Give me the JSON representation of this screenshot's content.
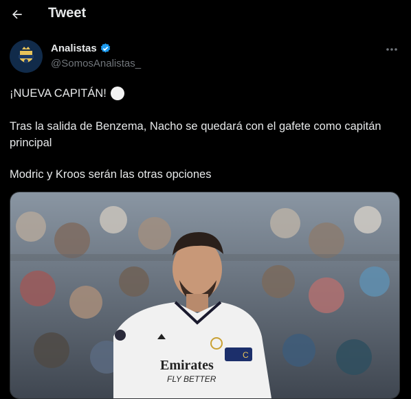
{
  "header": {
    "title": "Tweet",
    "back_icon": "arrow-left-icon"
  },
  "author": {
    "name": "Analistas",
    "handle": "@SomosAnalistas_",
    "verified_icon": "verified-badge-icon",
    "verified_color": "#1d9bf0",
    "avatar_icon": "club-crest-icon",
    "more_icon": "more-horizontal-icon"
  },
  "tweet": {
    "line1": "¡NUEVA CAPITÁN!",
    "line1_emoji": "white-circle-icon",
    "line2": "Tras la salida de Benzema, Nacho se quedará con el gafete como capitán principal",
    "line3": "Modric y Kroos serán las otras opciones"
  },
  "media": {
    "description_icon": "football-player-photo",
    "sponsor_line1": "Emirates",
    "sponsor_line2": "FLY BETTER",
    "armband_text": "C"
  },
  "colors": {
    "background": "#000000",
    "text": "#e7e9ea",
    "muted": "#71767b",
    "accent": "#1d9bf0"
  }
}
